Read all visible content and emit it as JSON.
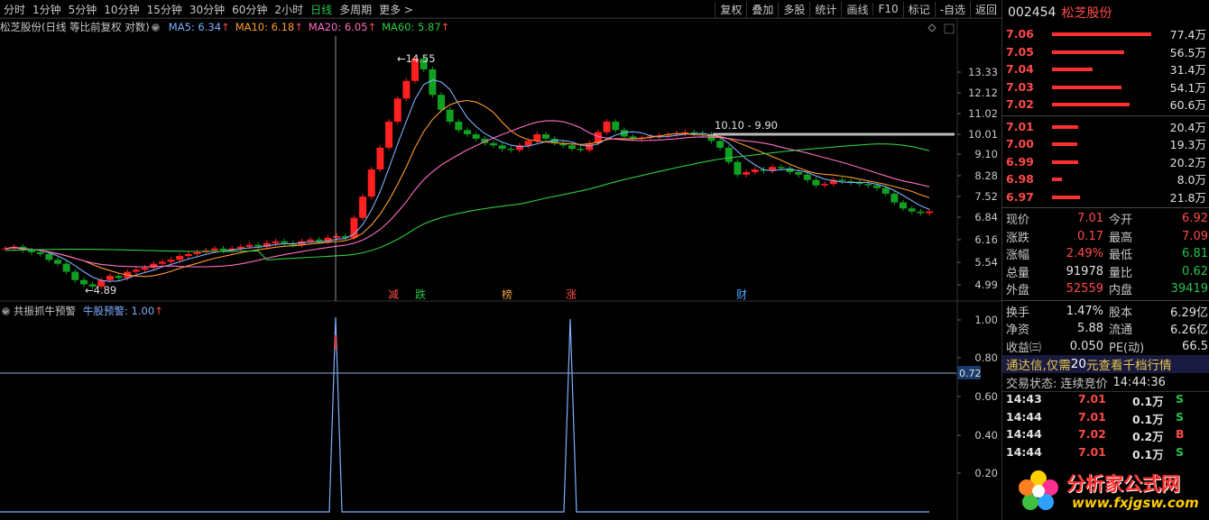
{
  "toolbar": {
    "periods": [
      "分时",
      "1分钟",
      "5分钟",
      "10分钟",
      "15分钟",
      "30分钟",
      "60分钟",
      "2小时",
      "日线",
      "多周期",
      "更多 >"
    ],
    "active_period": "日线",
    "tools": [
      "复权",
      "叠加",
      "多股",
      "统计",
      "画线",
      "F10",
      "标记",
      "-自选",
      "返回"
    ]
  },
  "main_chart": {
    "title": "松芝股份(日线 等比前复权 对数)",
    "ma": [
      {
        "label": "MA5: 6.34",
        "color": "#7fb0ff"
      },
      {
        "label": "MA10: 6.18",
        "color": "#ff9a2e"
      },
      {
        "label": "MA20: 6.05",
        "color": "#ff6ec7"
      },
      {
        "label": "MA60: 5.87",
        "color": "#2ecc40"
      }
    ],
    "y_ticks": [
      "13.33",
      "12.12",
      "11.02",
      "10.01",
      "9.10",
      "8.28",
      "7.52",
      "6.84",
      "6.16",
      "5.54",
      "4.99"
    ],
    "annotations": {
      "high": "14.55",
      "low": "4.89",
      "range": "10.10 - 9.90"
    },
    "events": [
      {
        "label": "减",
        "color": "#ff4a4a"
      },
      {
        "label": "跌",
        "color": "#27c24c"
      },
      {
        "label": "榜",
        "color": "#e6a23c"
      },
      {
        "label": "涨",
        "color": "#ff4a4a"
      },
      {
        "label": "财",
        "color": "#4da6ff"
      }
    ]
  },
  "indicator": {
    "title": "共振抓牛预警",
    "line_label": "牛股预警: 1.00",
    "y_ticks": [
      "1.00",
      "0.80",
      "0.60",
      "0.40",
      "0.20"
    ],
    "cursor_value": "0.72"
  },
  "quote": {
    "code": "002454",
    "name": "松芝股份",
    "asks": [
      {
        "price": "7.06",
        "vol": "77.4万",
        "bar": 1.0
      },
      {
        "price": "7.05",
        "vol": "56.5万",
        "bar": 0.73
      },
      {
        "price": "7.04",
        "vol": "31.4万",
        "bar": 0.41
      },
      {
        "price": "7.03",
        "vol": "54.1万",
        "bar": 0.7
      },
      {
        "price": "7.02",
        "vol": "60.6万",
        "bar": 0.78
      }
    ],
    "bids": [
      {
        "price": "7.01",
        "vol": "20.4万",
        "bar": 0.26
      },
      {
        "price": "7.00",
        "vol": "19.3万",
        "bar": 0.25
      },
      {
        "price": "6.99",
        "vol": "20.2万",
        "bar": 0.26
      },
      {
        "price": "6.98",
        "vol": "8.0万",
        "bar": 0.1
      },
      {
        "price": "6.97",
        "vol": "21.8万",
        "bar": 0.28
      }
    ],
    "stats": [
      {
        "l1": "现价",
        "v1": "7.01",
        "c1": "red",
        "l2": "今开",
        "v2": "6.92",
        "c2": "red"
      },
      {
        "l1": "涨跌",
        "v1": "0.17",
        "c1": "red",
        "l2": "最高",
        "v2": "7.09",
        "c2": "red"
      },
      {
        "l1": "涨幅",
        "v1": "2.49%",
        "c1": "red",
        "l2": "最低",
        "v2": "6.81",
        "c2": "green"
      },
      {
        "l1": "总量",
        "v1": "91978",
        "c1": "white",
        "l2": "量比",
        "v2": "0.62",
        "c2": "green"
      },
      {
        "l1": "外盘",
        "v1": "52559",
        "c1": "red",
        "l2": "内盘",
        "v2": "39419",
        "c2": "green"
      }
    ],
    "stats2": [
      {
        "l1": "换手",
        "v1": "1.47%",
        "c1": "white",
        "l2": "股本",
        "v2": "6.29亿",
        "c2": "white"
      },
      {
        "l1": "净资",
        "v1": "5.88",
        "c1": "white",
        "l2": "流通",
        "v2": "6.26亿",
        "c2": "white"
      },
      {
        "l1": "收益㈢",
        "v1": "0.050",
        "c1": "white",
        "l2": "PE(动)",
        "v2": "66.5",
        "c2": "white"
      }
    ],
    "ad_pre": "通达信,仅需",
    "ad_num": "20",
    "ad_post": "元查看千档行情",
    "trade_status_label": "交易状态: 连续竞价",
    "trade_status_time": "14:44:36",
    "ticks": [
      {
        "time": "14:43",
        "price": "7.01",
        "vol": "0.1万",
        "side": "S",
        "sc": "#27c24c"
      },
      {
        "time": "14:44",
        "price": "7.01",
        "vol": "0.1万",
        "side": "S",
        "sc": "#27c24c"
      },
      {
        "time": "14:44",
        "price": "7.02",
        "vol": "0.2万",
        "side": "B",
        "sc": "#ff4a4a"
      },
      {
        "time": "14:44",
        "price": "7.01",
        "vol": "0.1万",
        "side": "S",
        "sc": "#27c24c"
      }
    ]
  },
  "watermark": {
    "line1": "分析家公式网",
    "line2": "www.fxjgsw.com"
  },
  "colors": {
    "up": "#ff2020",
    "down": "#10a020",
    "ma5": "#7fb0ff",
    "ma10": "#ff9a2e",
    "ma20": "#ff6ec7",
    "ma60": "#2ecc40"
  }
}
